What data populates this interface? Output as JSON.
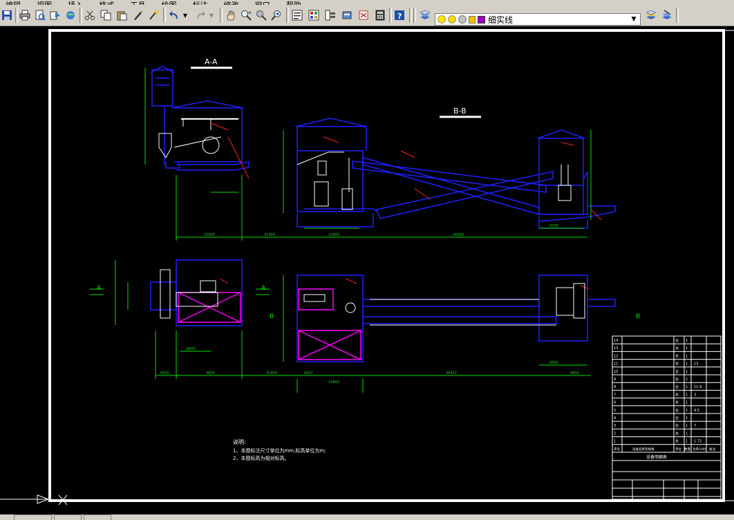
{
  "menu": {
    "items": [
      "编辑",
      "视图",
      "插入",
      "格式",
      "工具",
      "绘图",
      "标注",
      "修改",
      "窗口",
      "帮助"
    ]
  },
  "toolbar": {
    "layer_name": "细实线",
    "icons": [
      "save-icon",
      "print-icon",
      "print-preview-icon",
      "publish-icon",
      "3d-dwf-icon",
      "cut-icon",
      "copy-icon",
      "paste-icon",
      "match-properties-icon",
      "undo-icon",
      "redo-icon",
      "pan-icon",
      "zoom-realtime-icon",
      "zoom-window-icon",
      "zoom-previous-icon",
      "properties-icon",
      "design-center-icon",
      "tool-palettes-icon",
      "sheet-set-icon",
      "markup-icon",
      "calculator-icon",
      "help-icon",
      "layer-manager-icon",
      "layer-previous-icon"
    ]
  },
  "drawing": {
    "section_aa": "A-A",
    "section_bb": "B-B",
    "marker_a": "A",
    "marker_b": "B",
    "notes_title": "说明:",
    "note_1": "1、本图标注尺寸单位为mm,标高单位为m;",
    "note_2": "2、本图标高为相对标高。",
    "dims": [
      "15600",
      "31404",
      "15800",
      "36909",
      "4700",
      "9000",
      "4800",
      "6000",
      "31404",
      "4007",
      "15800",
      "36452",
      "4500",
      "4800"
    ],
    "table": {
      "rows": [
        {
          "no": "14",
          "name": "",
          "unit": "台",
          "qty": "1"
        },
        {
          "no": "13",
          "name": "",
          "unit": "台",
          "qty": "1"
        },
        {
          "no": "12",
          "name": "",
          "unit": "台",
          "qty": "1"
        },
        {
          "no": "11",
          "name": "",
          "unit": "台",
          "qty": "1",
          "extra": "13"
        },
        {
          "no": "10",
          "name": "",
          "unit": "台",
          "qty": "1"
        },
        {
          "no": "9",
          "name": "",
          "unit": "台",
          "qty": "1"
        },
        {
          "no": "8",
          "name": "",
          "unit": "台",
          "qty": "1",
          "extra": "11.9"
        },
        {
          "no": "7",
          "name": "",
          "unit": "台",
          "qty": "1",
          "extra": "3"
        },
        {
          "no": "6",
          "name": "",
          "unit": "台",
          "qty": "1"
        },
        {
          "no": "5",
          "name": "",
          "unit": "台",
          "qty": "1",
          "extra": "4.5"
        },
        {
          "no": "4",
          "name": "",
          "unit": "台",
          "qty": "1"
        },
        {
          "no": "3",
          "name": "",
          "unit": "台",
          "qty": "1",
          "extra": "7"
        },
        {
          "no": "2",
          "name": "",
          "unit": "台",
          "qty": "1"
        },
        {
          "no": "1",
          "name": "",
          "unit": "台",
          "qty": "1",
          "extra": "1.72"
        }
      ],
      "header": [
        "序号",
        "设备名称及规格",
        "单位",
        "数量",
        "功率(kW)",
        "备注"
      ],
      "title": "设备明细表",
      "footer_rows": [
        "",
        "",
        ""
      ]
    }
  },
  "colors": {
    "canvas": "#000000",
    "frame": "#ffffff",
    "blue": "#2020ff",
    "magenta": "#ff00ff",
    "green": "#00e000",
    "red": "#ff2020",
    "white": "#ffffff"
  }
}
